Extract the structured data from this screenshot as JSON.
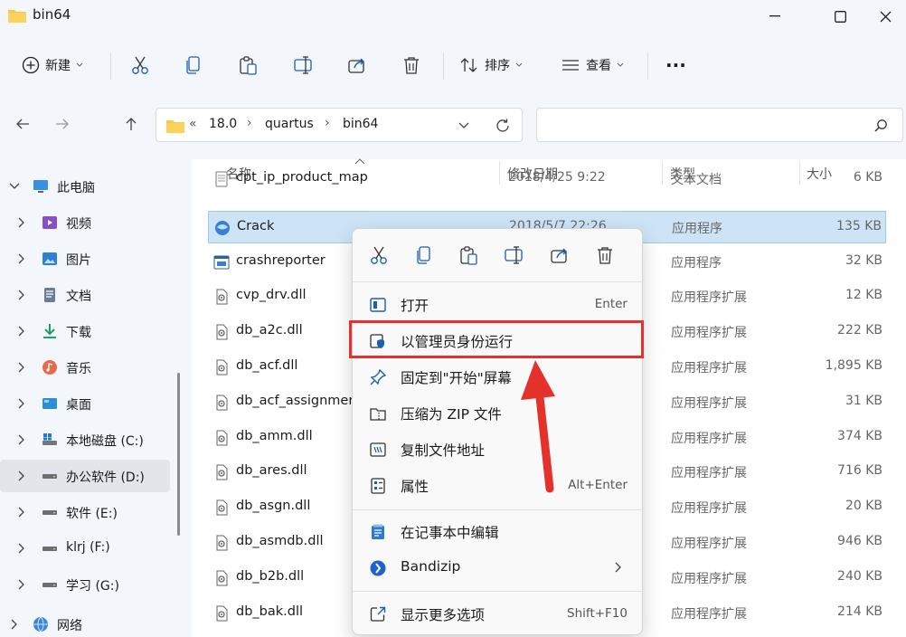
{
  "window": {
    "title": "bin64"
  },
  "toolbar": {
    "new_label": "新建",
    "sort_label": "排序",
    "view_label": "查看",
    "more_label": "···"
  },
  "address": {
    "overflow": "«",
    "crumbs": [
      "18.0",
      "quartus",
      "bin64"
    ],
    "separator": "›"
  },
  "search": {
    "placeholder": ""
  },
  "nav": {
    "items": [
      {
        "label": "此电脑",
        "icon": "pc-icon"
      },
      {
        "label": "视频",
        "icon": "video-folder-icon"
      },
      {
        "label": "图片",
        "icon": "pictures-folder-icon"
      },
      {
        "label": "文档",
        "icon": "documents-folder-icon"
      },
      {
        "label": "下载",
        "icon": "downloads-folder-icon"
      },
      {
        "label": "音乐",
        "icon": "music-folder-icon"
      },
      {
        "label": "桌面",
        "icon": "desktop-folder-icon"
      },
      {
        "label": "本地磁盘 (C:)",
        "icon": "drive-c-icon"
      },
      {
        "label": "办公软件 (D:)",
        "icon": "drive-icon"
      },
      {
        "label": "软件 (E:)",
        "icon": "drive-icon"
      },
      {
        "label": "klrj (F:)",
        "icon": "drive-icon"
      },
      {
        "label": "学习 (G:)",
        "icon": "drive-icon"
      },
      {
        "label": "网络",
        "icon": "network-icon"
      }
    ]
  },
  "columns": {
    "name": "名称",
    "date": "修改日期",
    "type": "类型",
    "size": "大小"
  },
  "files": [
    {
      "name": "cpt_ip_product_map",
      "date": "2018/4/25 9:22",
      "type": "文本文档",
      "size": "6 KB"
    },
    {
      "name": "Crack",
      "date": "2018/5/7 22:26",
      "type": "应用程序",
      "size": "135 KB"
    },
    {
      "name": "crashreporter",
      "date": "",
      "type": "应用程序",
      "size": "32 KB"
    },
    {
      "name": "cvp_drv.dll",
      "date": "",
      "type": "应用程序扩展",
      "size": "12 KB"
    },
    {
      "name": "db_a2c.dll",
      "date": "",
      "type": "应用程序扩展",
      "size": "222 KB"
    },
    {
      "name": "db_acf.dll",
      "date": "",
      "type": "应用程序扩展",
      "size": "1,895 KB"
    },
    {
      "name": "db_acf_assignmer",
      "date": "",
      "type": "应用程序扩展",
      "size": "31 KB"
    },
    {
      "name": "db_amm.dll",
      "date": "",
      "type": "应用程序扩展",
      "size": "374 KB"
    },
    {
      "name": "db_ares.dll",
      "date": "",
      "type": "应用程序扩展",
      "size": "716 KB"
    },
    {
      "name": "db_asgn.dll",
      "date": "",
      "type": "应用程序扩展",
      "size": "20 KB"
    },
    {
      "name": "db_asmdb.dll",
      "date": "",
      "type": "应用程序扩展",
      "size": "946 KB"
    },
    {
      "name": "db_b2b.dll",
      "date": "",
      "type": "应用程序扩展",
      "size": "240 KB"
    },
    {
      "name": "db_bak.dll",
      "date": "",
      "type": "应用程序扩展",
      "size": "214 KB"
    }
  ],
  "context_menu": {
    "items": [
      {
        "label": "打开",
        "shortcut": "Enter"
      },
      {
        "label": "以管理员身份运行",
        "shortcut": ""
      },
      {
        "label": "固定到\"开始\"屏幕",
        "shortcut": ""
      },
      {
        "label": "压缩为 ZIP 文件",
        "shortcut": ""
      },
      {
        "label": "复制文件地址",
        "shortcut": ""
      },
      {
        "label": "属性",
        "shortcut": "Alt+Enter"
      },
      {
        "label": "在记事本中编辑",
        "shortcut": ""
      },
      {
        "label": "Bandizip",
        "shortcut": ""
      },
      {
        "label": "显示更多选项",
        "shortcut": "Shift+F10"
      }
    ]
  },
  "colors": {
    "accent": "#0067c0",
    "highlight": "#e5312b",
    "selection": "#cde4f7",
    "folder": "#f8c84a"
  }
}
